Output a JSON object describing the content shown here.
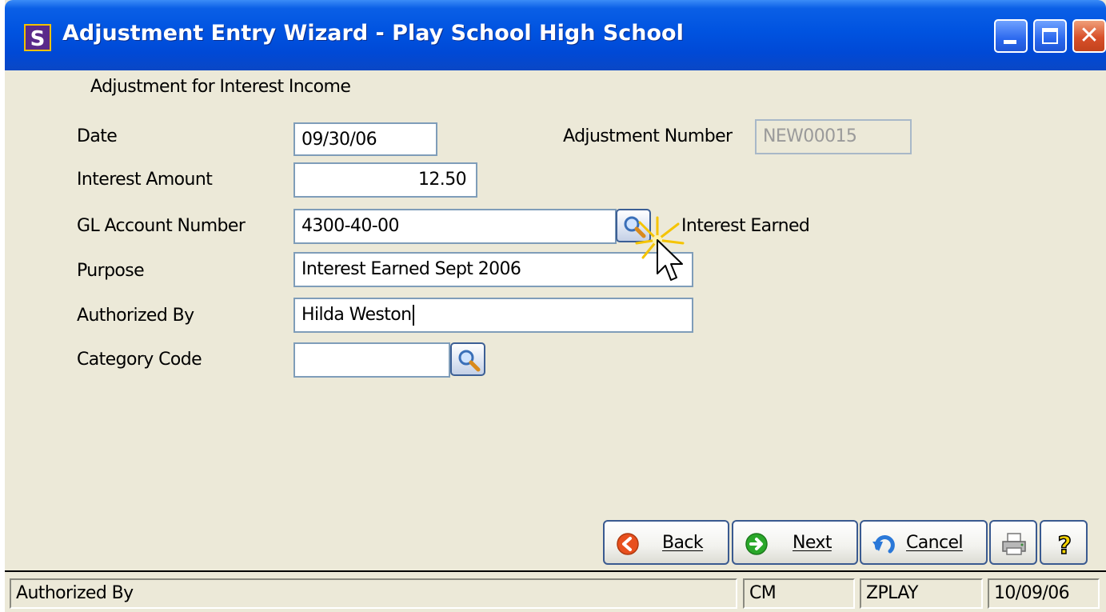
{
  "window": {
    "title": "Adjustment Entry Wizard - Play School High School",
    "app_icon_letter": "S"
  },
  "form": {
    "section_title": "Adjustment for Interest Income",
    "date": {
      "label": "Date",
      "value": "09/30/06"
    },
    "adjustment_number": {
      "label": "Adjustment Number",
      "value": "NEW00015"
    },
    "interest_amount": {
      "label": "Interest Amount",
      "value": "12.50"
    },
    "gl_account": {
      "label": "GL Account Number",
      "value": "4300-40-00",
      "description": "Interest Earned"
    },
    "purpose": {
      "label": "Purpose",
      "value": "Interest Earned Sept 2006"
    },
    "authorized_by": {
      "label": "Authorized By",
      "value": "Hilda Weston"
    },
    "category_code": {
      "label": "Category Code",
      "value": ""
    }
  },
  "buttons": {
    "back": "Back",
    "next": "Next",
    "cancel": "Cancel"
  },
  "status_bar": {
    "message": "Authorized By",
    "user": "CM",
    "database": "ZPLAY",
    "date": "10/09/06"
  },
  "icons": {
    "app": "app-icon",
    "lookup": "magnifier-icon",
    "back": "back-arrow-icon",
    "next": "next-arrow-icon",
    "cancel": "undo-icon",
    "print": "printer-icon",
    "help": "help-icon",
    "cursor": "mouse-pointer-icon"
  },
  "colors": {
    "titlebar": "#0053e0",
    "window_bg": "#ece9d8",
    "back_icon": "#e8501e",
    "next_icon": "#2aa82a"
  }
}
